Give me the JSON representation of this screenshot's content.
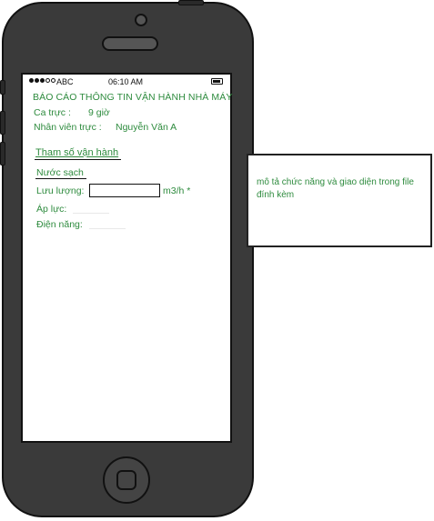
{
  "status_bar": {
    "carrier": "ABC",
    "time": "06:10 AM"
  },
  "report": {
    "title": "BÁO CÁO THÔNG TIN VẬN HÀNH NHÀ MÁY",
    "shift_label": "Ca trực :",
    "shift_value": "9  giờ",
    "staff_label": "Nhân viên  trực :",
    "staff_value": "Nguyễn Văn A"
  },
  "params": {
    "section_title": "Tham số vận hành",
    "subsection_title": "Nước sạch",
    "flow_label": "Lưu lượng:",
    "flow_value": "",
    "flow_unit": "m3/h *",
    "pressure_label": "Áp lực:",
    "energy_label": "Điện năng:"
  },
  "note": {
    "text": "mô tả chức năng và giao diện trong file đính kèm"
  }
}
